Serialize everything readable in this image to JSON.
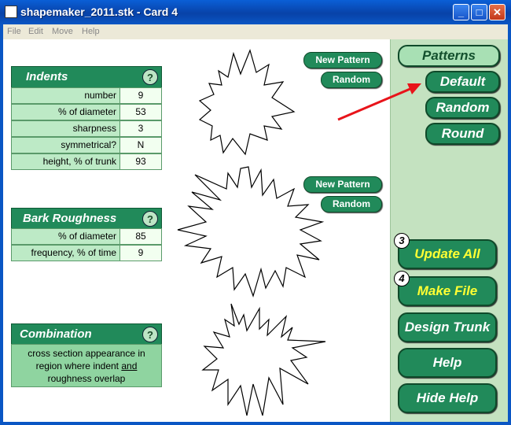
{
  "window": {
    "title": "shapemaker_2011.stk - Card 4"
  },
  "menu": [
    "File",
    "Edit",
    "Move",
    "Help"
  ],
  "indents": {
    "title": "Indents",
    "help": "?",
    "rows": [
      {
        "label": "number",
        "value": "9"
      },
      {
        "label": "% of diameter",
        "value": "53"
      },
      {
        "label": "sharpness",
        "value": "3"
      },
      {
        "label": "symmetrical?",
        "value": "N"
      },
      {
        "label": "height, % of trunk",
        "value": "93"
      }
    ]
  },
  "bark": {
    "title": "Bark Roughness",
    "help": "?",
    "rows": [
      {
        "label": "% of diameter",
        "value": "85"
      },
      {
        "label": "frequency, % of time",
        "value": "9"
      }
    ]
  },
  "combination": {
    "title": "Combination",
    "help": "?",
    "desc_line1": "cross section appearance in",
    "desc_line2a": "region where indent ",
    "desc_line2b": "and",
    "desc_line3": "roughness overlap"
  },
  "pattern_buttons": {
    "new_pattern": "New Pattern",
    "random": "Random"
  },
  "sidebar": {
    "patterns": "Patterns",
    "default": "Default",
    "random": "Random",
    "round": "Round",
    "update_badge": "3",
    "update_all": "Update All",
    "make_badge": "4",
    "make_file": "Make File",
    "design_trunk": "Design Trunk",
    "help": "Help",
    "hide_help": "Hide Help"
  },
  "colors": {
    "header_green": "#218a5a",
    "label_green": "#bdeac6",
    "panel_green": "#c4e2c0",
    "highlight_yellow": "#ffff33",
    "arrow_red": "#e8141a"
  },
  "icons": [
    "app-icon",
    "minimize-icon",
    "maximize-icon",
    "close-icon",
    "help-icon",
    "arrow-icon"
  ]
}
